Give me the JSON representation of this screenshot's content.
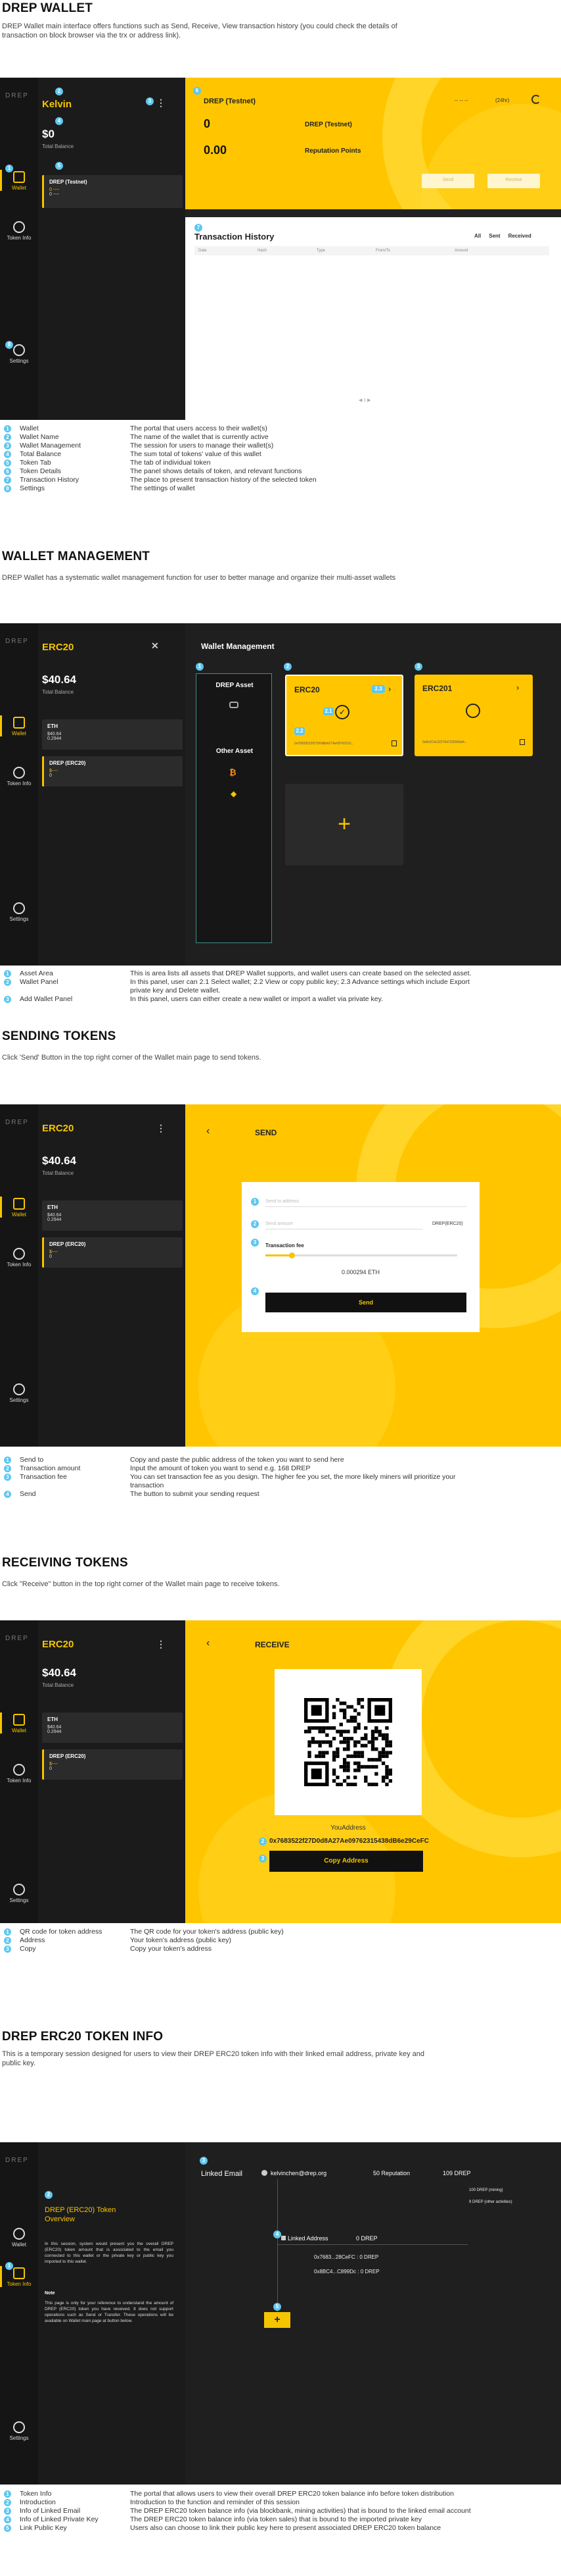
{
  "s1": {
    "title": "DREP WALLET",
    "desc": "DREP Wallet main interface offers functions such as Send, Receive, View transaction history (you could check the details of transaction on block browser via the trx or address link).",
    "logo": "DREP",
    "wallet_name": "Kelvin",
    "balance": "$0",
    "balance_label": "Total Balance",
    "token_card_name": "DREP (Testnet)",
    "token_card_value": "0 ----",
    "token_card_value2": "0 ----",
    "rail": {
      "wallet": "Wallet",
      "token_info": "Token Info",
      "settings": "Settings"
    },
    "token_detail": {
      "title": "DREP (Testnet)",
      "balance": "0",
      "balance_unit": "DREP (Testnet)",
      "reputation": "0.00",
      "reputation_label": "Reputation Points",
      "change": "(24hr)",
      "change_prefix": "-- -- --",
      "send": "Send",
      "receive": "Receive"
    },
    "tx": {
      "title": "Transaction History",
      "filters": [
        "All",
        "Sent",
        "Received"
      ],
      "columns": [
        "Date",
        "Hash",
        "Type",
        "From/To",
        "Amount"
      ]
    },
    "pager": "◀  1  ▶",
    "legend": [
      {
        "n": "1",
        "label": "Wallet",
        "desc": "The portal that users access to their wallet(s)"
      },
      {
        "n": "2",
        "label": "Wallet Name",
        "desc": "The name of the wallet that is currently active"
      },
      {
        "n": "3",
        "label": "Wallet Management",
        "desc": "The session for users to manage their wallet(s)"
      },
      {
        "n": "4",
        "label": "Total Balance",
        "desc": "The sum total of tokens' value of this wallet"
      },
      {
        "n": "5",
        "label": "Token Tab",
        "desc": "The tab of individual token"
      },
      {
        "n": "6",
        "label": "Token Details",
        "desc": "The panel shows details of token, and relevant functions"
      },
      {
        "n": "7",
        "label": "Transaction History",
        "desc": "The place to present transaction history of the selected token"
      },
      {
        "n": "8",
        "label": "Settings",
        "desc": "The settings of wallet"
      }
    ]
  },
  "s2": {
    "title": "WALLET MANAGEMENT",
    "desc": "DREP Wallet has a systematic wallet management function for user to better manage and organize their multi-asset wallets",
    "wallet_name": "ERC20",
    "balance": "$40.64",
    "balance_label": "Total Balance",
    "card1": {
      "name": "ETH",
      "v1": "$40.64",
      "v2": "0.2944"
    },
    "card2": {
      "name": "DREP (ERC20)",
      "v1": "$----",
      "v2": "0"
    },
    "panel_title": "Wallet Management",
    "drep_asset": "DREP Asset",
    "other_asset": "Other Asset",
    "w1_name": "ERC20",
    "w1_addr": "0x76833522f27D0d8bA27Ae09762315...",
    "w2_name": "ERC201",
    "w2_addr": "0x8c0C4c32270d7230960d4...",
    "add": "+",
    "legend": [
      {
        "n": "1",
        "label": "Asset Area",
        "desc": "This is area lists all assets that DREP Wallet supports, and wallet users can create based on the selected asset."
      },
      {
        "n": "2",
        "label": "Wallet Panel",
        "desc": "In this panel, user can 2.1 Select wallet; 2.2 View or copy public key; 2.3 Advance settings which include Export"
      },
      {
        "n": "",
        "label": "",
        "desc": "private key and Delete wallet."
      },
      {
        "n": "3",
        "label": "Add Wallet Panel",
        "desc": "In this panel, users can either create a new wallet or import a wallet via private key."
      }
    ]
  },
  "s3": {
    "title": "SENDING TOKENS",
    "desc": "Click 'Send' Button in the top right corner of the Wallet main page to send tokens.",
    "header": "SEND",
    "send_to_ph": "Send to address",
    "amount_ph": "Send amount",
    "amount_unit": "DREP(ERC20)",
    "fee_label": "Transaction fee",
    "fee_value": "0.000294 ETH",
    "send_btn": "Send",
    "legend": [
      {
        "n": "1",
        "label": "Send to",
        "desc": "Copy and paste the public address of the token you want to send here"
      },
      {
        "n": "2",
        "label": "Transaction amount",
        "desc": "Input the amount of token you want to send e.g. 168 DREP"
      },
      {
        "n": "3",
        "label": "Transaction fee",
        "desc": "You can set transaction fee as you design. The higher fee you set, the more likely miners will prioritize your"
      },
      {
        "n": "",
        "label": "",
        "desc": "transaction"
      },
      {
        "n": "4",
        "label": "Send",
        "desc": "The button to submit your sending request"
      }
    ]
  },
  "s4": {
    "title": "RECEIVING TOKENS",
    "desc": "Click \"Receive\" button in the top right corner of the Wallet main page to receive tokens.",
    "header": "RECEIVE",
    "your_address": "YouAddress",
    "address": "0x7683522f27D0d8A27Ae09762315438dB6e29CeFC",
    "copy_btn": "Copy Address",
    "legend": [
      {
        "n": "1",
        "label": "QR code for token address",
        "desc": "The QR code for your token's address (public key)"
      },
      {
        "n": "2",
        "label": "Address",
        "desc": "Your token's address (public key)"
      },
      {
        "n": "3",
        "label": "Copy",
        "desc": "Copy your token's address"
      }
    ]
  },
  "s5": {
    "title": "DREP ERC20 TOKEN INFO",
    "desc": "This is a temporary session designed for users to view their DREP ERC20 token info with their linked email address, private key and public key.",
    "overview_title": "DREP (ERC20) Token Overview",
    "intro": "In this session, system would present you the overall DREP (ERC20) token amount that is associated to the email you connected to this wallet or the private key or public key you imported to this wallet.",
    "note_title": "Note",
    "note": "This page is only for your reference to understand the amount of DREP (ERC20) token you have received. It does not support operations such as Send or Transfer. These operations will be available on Wallet main page at button below.",
    "linked_email_label": "Linked Email",
    "linked_email": "kelvinchen@drep.org",
    "reputation": "50 Reputation",
    "drep_total": "109 DREP",
    "mining": "100 DREP (mining)",
    "other": "9 DREP (other activities)",
    "linked_address_label": "Linked Address",
    "linked_address_total": "0 DREP",
    "addr1": "0x7683...28CeFC : 0 DREP",
    "addr2": "0x8BC4...C899Dc : 0 DREP",
    "add": "+",
    "legend": [
      {
        "n": "1",
        "label": "Token Info",
        "desc": "The portal that allows users to view their overall DREP ERC20 token balance info before token distribution"
      },
      {
        "n": "2",
        "label": "Introduction",
        "desc": "Introduction to the function and reminder of this session"
      },
      {
        "n": "3",
        "label": "Info of Linked Email",
        "desc": "The DREP ERC20 token balance info (via blockbank, mining activities) that is bound to the linked email account"
      },
      {
        "n": "4",
        "label": "Info of Linked Private Key",
        "desc": "The DREP ERC20 token balance info (via token sales) that is bound to the imported private key"
      },
      {
        "n": "5",
        "label": "Link Public Key",
        "desc": "Users also can choose to link their public key here to present associated DREP ERC20 token balance"
      }
    ]
  }
}
